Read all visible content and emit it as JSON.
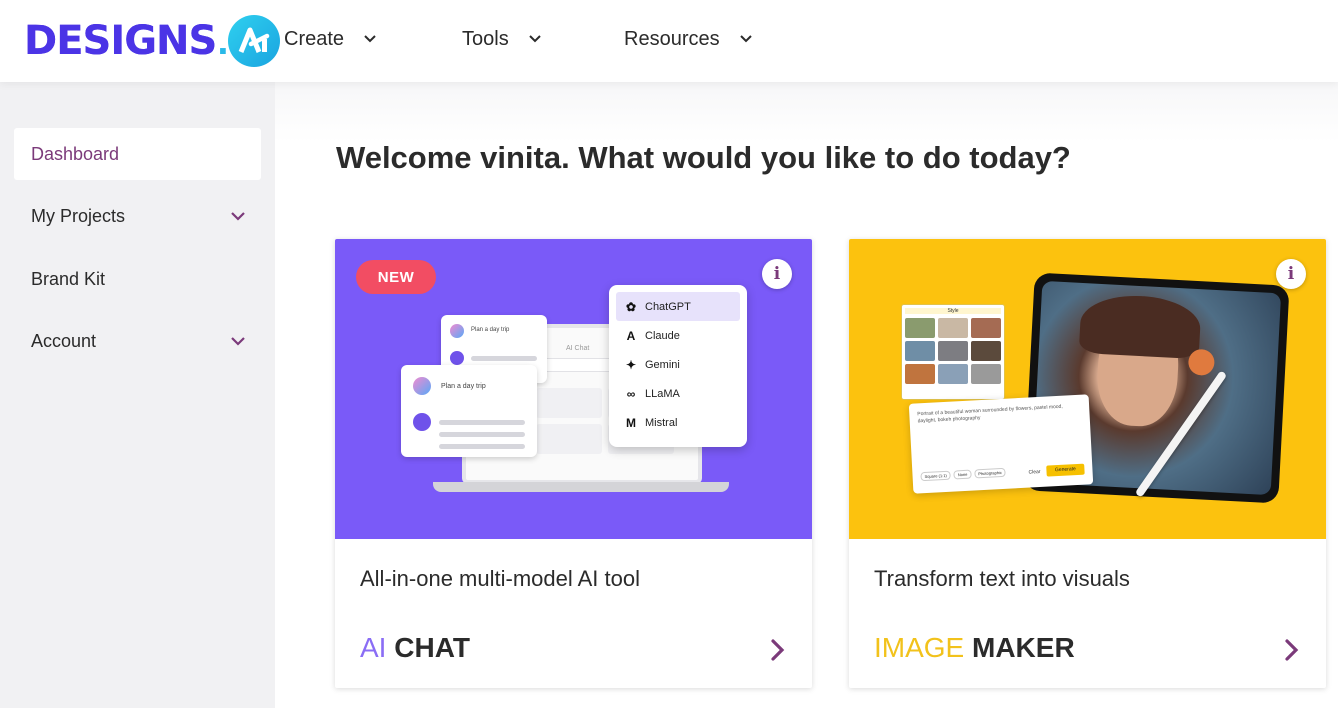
{
  "header": {
    "logo_text": "DESIGNS",
    "logo_suffix": "AI",
    "nav": [
      {
        "label": "Create"
      },
      {
        "label": "Tools"
      },
      {
        "label": "Resources"
      }
    ]
  },
  "sidebar": {
    "items": [
      {
        "label": "Dashboard",
        "active": true
      },
      {
        "label": "My Projects",
        "expandable": true
      },
      {
        "label": "Brand Kit"
      },
      {
        "label": "Account",
        "expandable": true
      }
    ]
  },
  "main": {
    "welcome": "Welcome vinita. What would you like to do today?",
    "cards": [
      {
        "badge": "NEW",
        "info": "i",
        "title": "All-in-one multi-model AI tool",
        "brand_prefix": "AI",
        "brand_suffix": "CHAT",
        "image_bg": "#7a5af8",
        "accent": "#8a6df5",
        "illustration": {
          "chat_title": "AI Chat",
          "prompt_a": "Plan a day trip",
          "prompt_b": "Plan a day trip",
          "models": [
            "ChatGPT",
            "Claude",
            "Gemini",
            "LLaMA",
            "Mistral"
          ]
        }
      },
      {
        "info": "i",
        "title": "Transform text into visuals",
        "brand_prefix": "IMAGE",
        "brand_suffix": "MAKER",
        "image_bg": "#fcc20e",
        "accent": "#f2c21b",
        "illustration": {
          "style_label": "Style",
          "prompt_text": "Portrait of a beautiful woman surrounded by flowers, pastel mood, daylight, bokeh photography",
          "tags": [
            "Square (1:1)",
            "None",
            "Photographic"
          ],
          "clear": "Clear",
          "generate": "Generate"
        }
      }
    ]
  },
  "colors": {
    "brand_purple": "#7b3a7a",
    "sidebar_bg": "#f1f1f3"
  }
}
